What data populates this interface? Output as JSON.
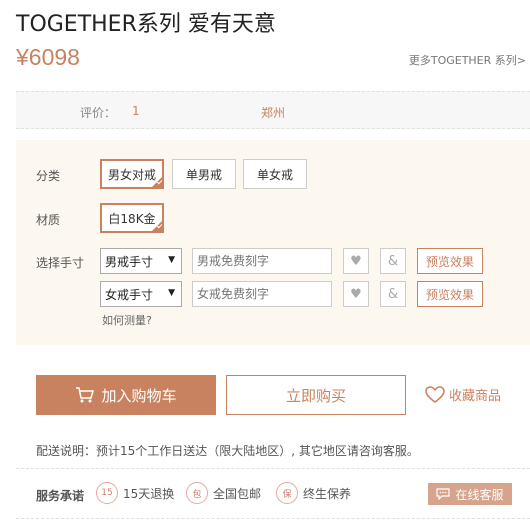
{
  "product": {
    "title": "TOGETHER系列 爱有天意",
    "price": "¥6098",
    "more_link": "更多TOGETHER 系列>"
  },
  "info": {
    "rating_label": "评价：",
    "rating_value": "1",
    "city": "郑州"
  },
  "options": {
    "category_label": "分类",
    "categories": [
      {
        "label": "男女对戒",
        "selected": true
      },
      {
        "label": "单男戒",
        "selected": false
      },
      {
        "label": "单女戒",
        "selected": false
      }
    ],
    "material_label": "材质",
    "material": {
      "label": "白18K金",
      "selected": true
    },
    "size_label": "选择手寸",
    "male_size": {
      "value": "男戒手寸",
      "engrave_placeholder": "男戒免费刻字",
      "heart_icon": "heart-icon",
      "amp": "&",
      "preview": "预览效果"
    },
    "female_size": {
      "value": "女戒手寸",
      "engrave_placeholder": "女戒免费刻字",
      "heart_icon": "heart-icon",
      "amp": "&",
      "preview": "预览效果"
    },
    "how_to_measure": "如何测量?"
  },
  "actions": {
    "add_to_cart": "加入购物车",
    "buy_now": "立即购买",
    "favorite": "收藏商品"
  },
  "delivery_note": "配送说明：预计15个工作日送达（限大陆地区）, 其它地区请咨询客服。",
  "service": {
    "label": "服务承诺",
    "items": [
      {
        "badge": "15",
        "text": "15天退换"
      },
      {
        "badge": "包",
        "text": "全国包邮"
      },
      {
        "badge": "保",
        "text": "终生保养"
      }
    ],
    "online_service": "在线客服"
  },
  "colors": {
    "accent": "#c8825f",
    "options_bg": "#fdf8ef"
  }
}
